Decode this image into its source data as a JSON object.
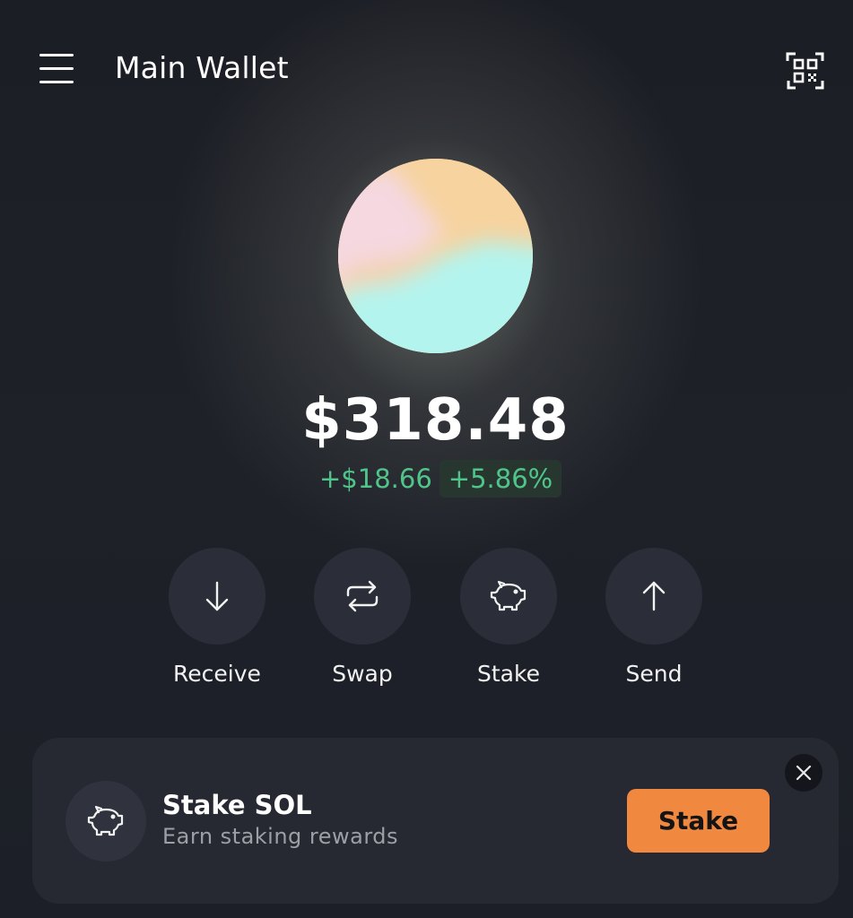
{
  "header": {
    "title": "Main Wallet",
    "menu_icon": "hamburger-menu-icon",
    "scan_icon": "qr-scan-icon"
  },
  "balance": {
    "total": "$318.48",
    "change_abs": "+$18.66",
    "change_pct": "+5.86%"
  },
  "actions": [
    {
      "label": "Receive",
      "icon": "arrow-down-icon"
    },
    {
      "label": "Swap",
      "icon": "swap-arrows-icon"
    },
    {
      "label": "Stake",
      "icon": "piggy-bank-icon"
    },
    {
      "label": "Send",
      "icon": "arrow-up-icon"
    }
  ],
  "promo": {
    "title": "Stake SOL",
    "subtitle": "Earn staking rewards",
    "button_label": "Stake",
    "icon": "piggy-bank-icon",
    "close_icon": "close-icon"
  },
  "colors": {
    "background": "#1c1e25",
    "positive": "#4fc58a",
    "accent": "#f0883f",
    "card": "#262932"
  }
}
